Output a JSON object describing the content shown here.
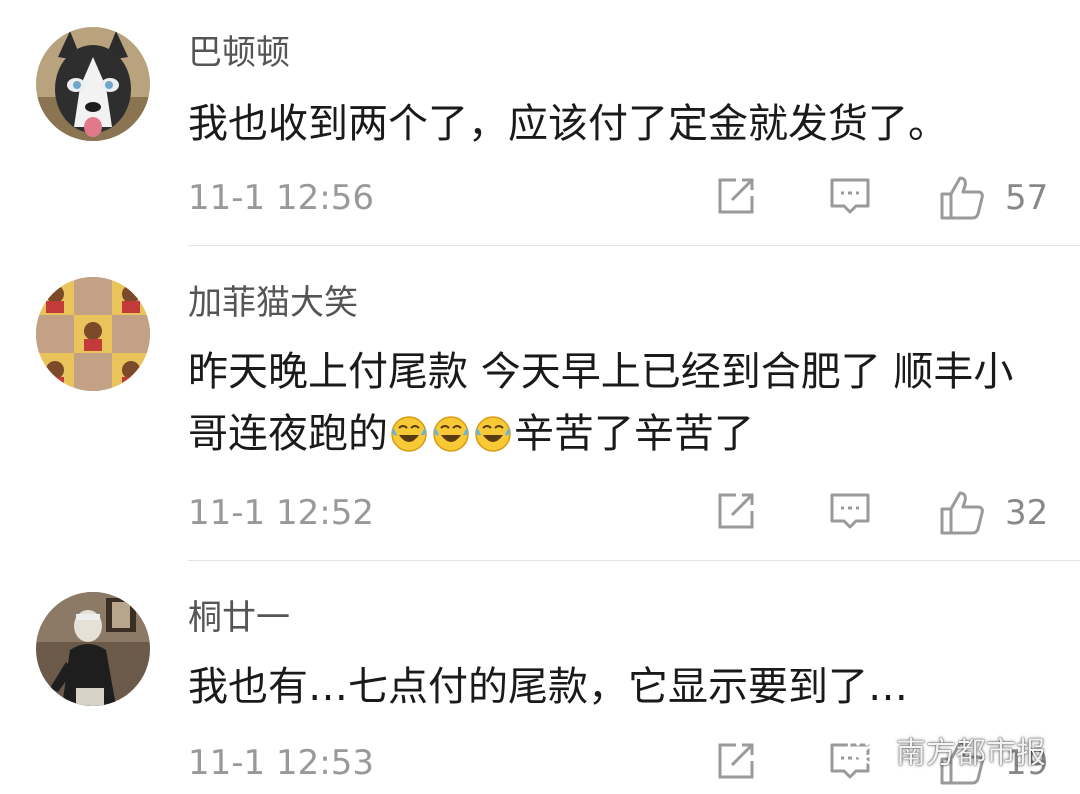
{
  "comments": [
    {
      "username": "巴顿顿",
      "text": "我也收到两个了，应该付了定金就发货了。",
      "time": "11-1 12:56",
      "likes": "57",
      "avatar": "husky-dog-avatar"
    },
    {
      "username": "加菲猫大笑",
      "text_part1": "昨天晚上付尾款 今天早上已经到合肥了 顺丰小哥连夜跑的",
      "emoji": "laughing-crying-emoji",
      "text_part2": "辛苦了辛苦了",
      "time": "11-1 12:52",
      "likes": "32",
      "avatar": "checkerboard-photo-avatar"
    },
    {
      "username": "桐廿一",
      "text": "我也有…七点付的尾款，它显示要到了…",
      "time": "11-1 12:53",
      "likes": "19",
      "avatar": "person-photo-avatar"
    }
  ],
  "icons": {
    "forward": "forward-icon",
    "reply": "comment-icon",
    "like": "thumbs-up-icon"
  },
  "watermark": {
    "text": "南方都市报",
    "icon": "wechat-icon"
  },
  "colors": {
    "username": "#555555",
    "text": "#1a1a1a",
    "meta": "#999999",
    "divider": "#e4e4e4"
  }
}
